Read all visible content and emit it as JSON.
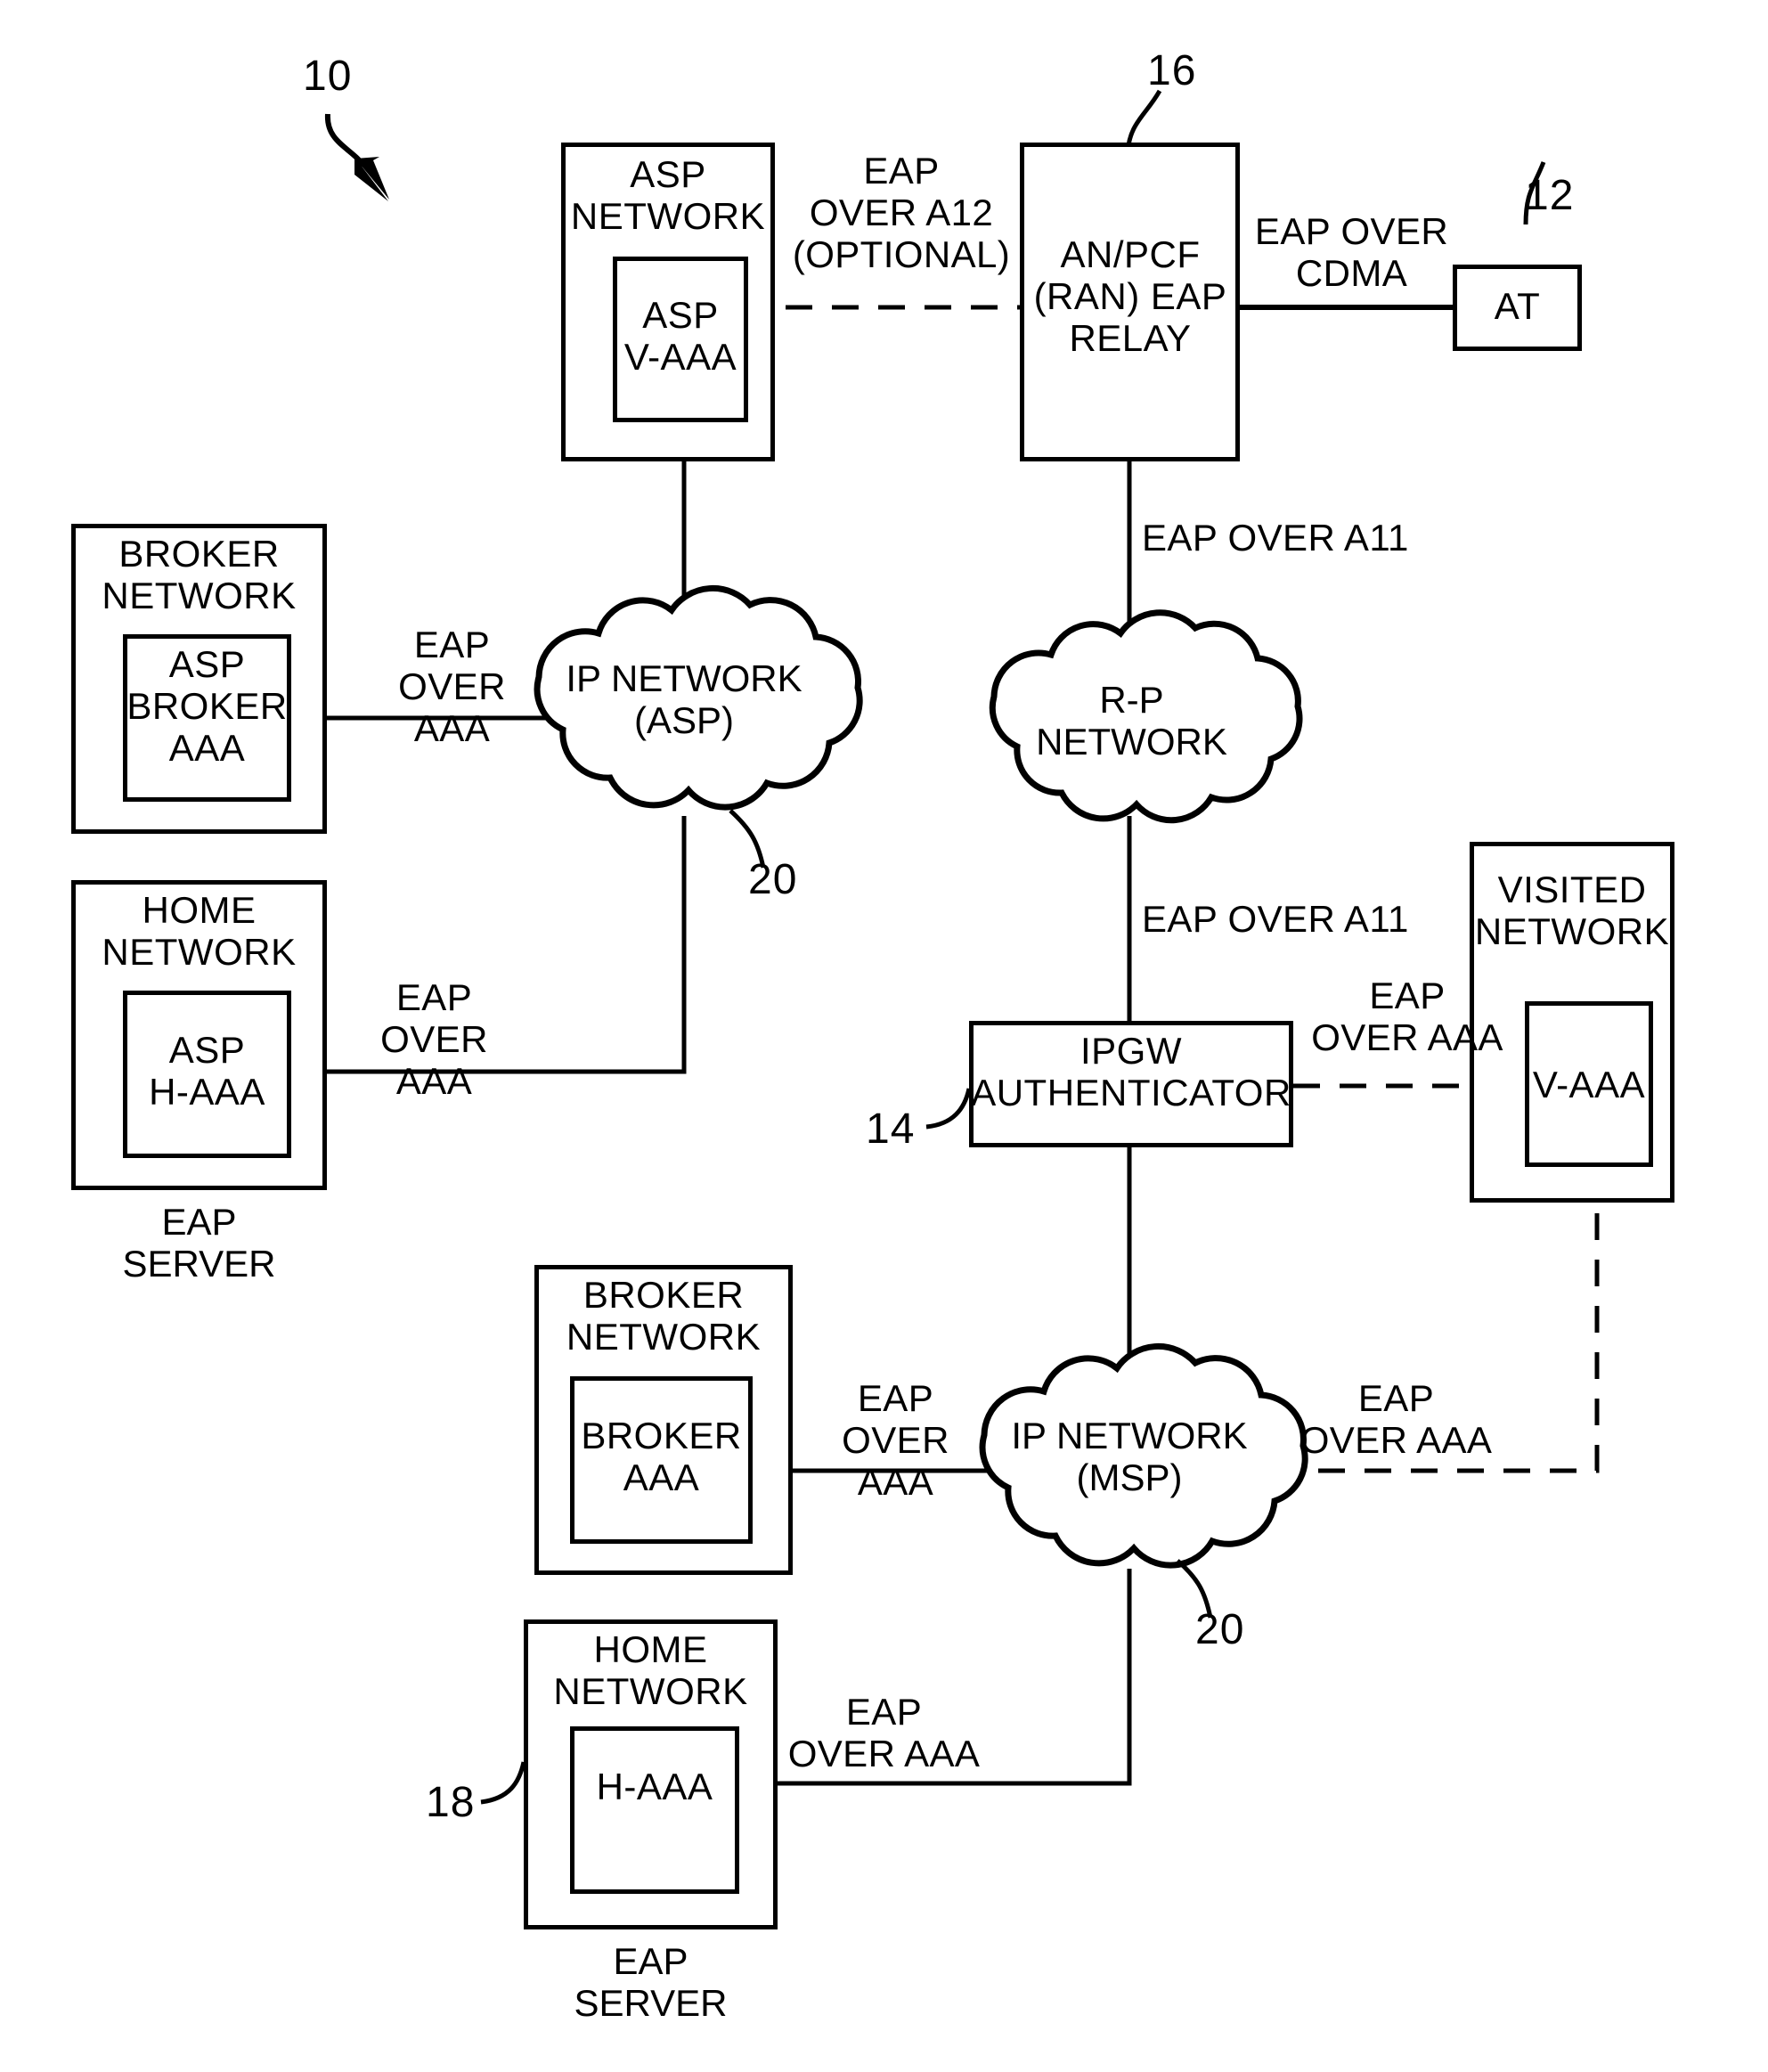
{
  "figure": {
    "ref_10": "10",
    "ref_12": "12",
    "ref_14": "14",
    "ref_16": "16",
    "ref_18": "18",
    "ref_20_asp": "20",
    "ref_20_msp": "20",
    "stroke_color": "#000000",
    "background_color": "#ffffff"
  },
  "nodes": {
    "asp_network": {
      "title": "ASP\nNETWORK",
      "inner": "ASP\nV-AAA"
    },
    "an_pcf": {
      "title": "AN/PCF\n(RAN) EAP\nRELAY"
    },
    "at": {
      "title": "AT"
    },
    "broker_network_asp": {
      "title": "BROKER\nNETWORK",
      "inner": "ASP\nBROKER\nAAA"
    },
    "home_network_asp": {
      "title": "HOME\nNETWORK",
      "inner": "ASP\nH-AAA",
      "caption": "EAP\nSERVER"
    },
    "ipgw": {
      "title": "IPGW\nAUTHENTICATOR"
    },
    "visited_network": {
      "title": "VISITED\nNETWORK",
      "inner": "V-AAA"
    },
    "broker_network_msp": {
      "title": "BROKER\nNETWORK",
      "inner": "BROKER\nAAA"
    },
    "home_network_msp": {
      "title": "HOME\nNETWORK",
      "inner": "H-AAA",
      "caption": "EAP\nSERVER"
    }
  },
  "clouds": {
    "ip_network_asp": "IP NETWORK\n(ASP)",
    "rp_network": "R-P\nNETWORK",
    "ip_network_msp": "IP NETWORK\n(MSP)"
  },
  "links": {
    "eap_over_a12": "EAP\nOVER A12\n(OPTIONAL)",
    "eap_over_cdma": "EAP OVER\nCDMA",
    "eap_over_aaa_broker_asp": "EAP\nOVER AAA",
    "eap_over_aaa_home_asp": "EAP\nOVER AAA",
    "eap_over_a11_top": "EAP OVER A11",
    "eap_over_a11_bottom": "EAP OVER A11",
    "eap_over_aaa_visited": "EAP\nOVER AAA",
    "eap_over_aaa_broker_msp": "EAP\nOVER AAA",
    "eap_over_aaa_msp_visited": "EAP\nOVER AAA",
    "eap_over_aaa_home_msp": "EAP\nOVER AAA"
  }
}
